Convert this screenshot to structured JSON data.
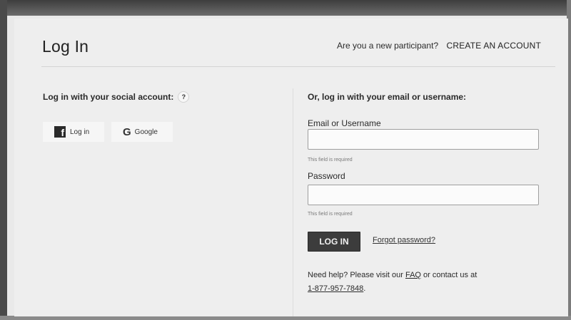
{
  "header": {
    "title": "Log In",
    "signup_prompt": "Are you a new participant?",
    "create_account_label": "CREATE AN ACCOUNT"
  },
  "social": {
    "heading": "Log in with your social account:",
    "help_icon_text": "?",
    "facebook_icon": "facebook-icon",
    "facebook_glyph": "f",
    "facebook_label": "Log in",
    "google_icon": "google-icon",
    "google_glyph": "G",
    "google_label": "Google"
  },
  "email_login": {
    "heading": "Or, log in with your email or username:",
    "email_label": "Email or Username",
    "email_value": "",
    "email_hint": "This field is required",
    "password_label": "Password",
    "password_value": "",
    "password_hint": "This field is required",
    "login_button_label": "LOG IN",
    "forgot_password_label": "Forgot password?",
    "help_text_before": "Need help? Please visit our ",
    "faq_label": "FAQ",
    "help_text_middle": " or contact us at ",
    "phone_label": "1-877-957-7848",
    "help_text_after": "."
  },
  "colors": {
    "button_bg": "#3c3c3c",
    "page_bg": "#eeeeee",
    "frame": "#5c5c5c"
  }
}
